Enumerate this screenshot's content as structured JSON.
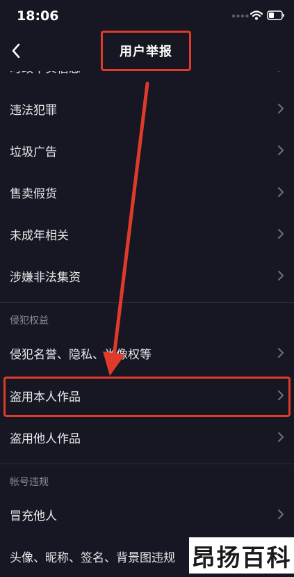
{
  "status_bar": {
    "time": "18:06"
  },
  "header": {
    "title": "用户举报",
    "back_icon": "chevron-left-icon"
  },
  "list": {
    "partial_top_row": "时政不实信息",
    "rows_group1": [
      {
        "label": "违法犯罪"
      },
      {
        "label": "垃圾广告"
      },
      {
        "label": "售卖假货"
      },
      {
        "label": "未成年相关"
      },
      {
        "label": "涉嫌非法集资"
      }
    ],
    "section_infringement": "侵犯权益",
    "rows_group2": [
      {
        "label": "侵犯名誉、隐私、肖像权等"
      },
      {
        "label": "盗用本人作品"
      },
      {
        "label": "盗用他人作品"
      }
    ],
    "section_account": "帐号违规",
    "rows_group3": [
      {
        "label": "冒充他人"
      },
      {
        "label": "头像、昵称、签名、背景图违规"
      }
    ]
  },
  "watermark": "昂扬百科",
  "colors": {
    "background": "#161722",
    "annotation_red": "#e03a2b",
    "section_text": "#8a8b93",
    "chevron": "#6f707a"
  }
}
